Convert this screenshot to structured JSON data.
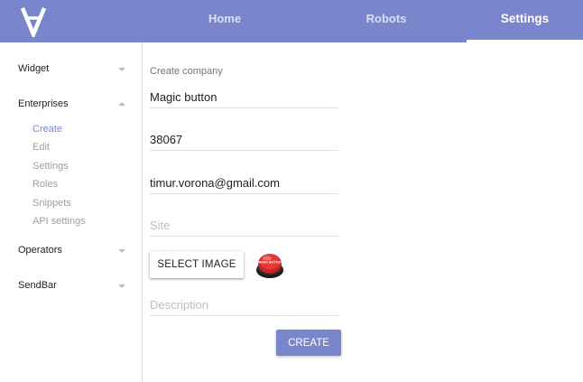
{
  "header": {
    "logo_icon": "inverted-a-logo",
    "tabs": [
      {
        "label": "Home",
        "active": false
      },
      {
        "label": "Robots",
        "active": false
      },
      {
        "label": "Settings",
        "active": true
      }
    ],
    "colors": {
      "bar": "#7986cb",
      "active_text": "#ffffff",
      "inactive_text": "rgba(255,255,255,0.72)"
    }
  },
  "sidebar": {
    "groups": [
      {
        "label": "Widget",
        "expanded": false,
        "icon": "chevron-down-icon"
      },
      {
        "label": "Enterprises",
        "expanded": true,
        "icon": "chevron-up-icon",
        "items": [
          {
            "label": "Create",
            "active": true
          },
          {
            "label": "Edit",
            "active": false
          },
          {
            "label": "Settings",
            "active": false
          },
          {
            "label": "Roles",
            "active": false
          },
          {
            "label": "Snippets",
            "active": false
          },
          {
            "label": "API settings",
            "active": false
          }
        ]
      },
      {
        "label": "Operators",
        "expanded": false,
        "icon": "chevron-down-icon"
      },
      {
        "label": "SendBar",
        "expanded": false,
        "icon": "chevron-down-icon"
      }
    ],
    "active_color": "#7986cb"
  },
  "form": {
    "title": "Create company",
    "fields": {
      "name": {
        "value": "Magic button",
        "placeholder": ""
      },
      "phone": {
        "value": "38067",
        "placeholder": ""
      },
      "email": {
        "value": "timur.vorona@gmail.com",
        "placeholder": ""
      },
      "site": {
        "value": "",
        "placeholder": "Site"
      },
      "description": {
        "value": "",
        "placeholder": "Description"
      }
    },
    "select_image_label": "SELECT IMAGE",
    "preview_image": {
      "icon": "magic-button-thumbnail",
      "text": "MAGIC BUTTON"
    },
    "create_label": "CREATE"
  }
}
